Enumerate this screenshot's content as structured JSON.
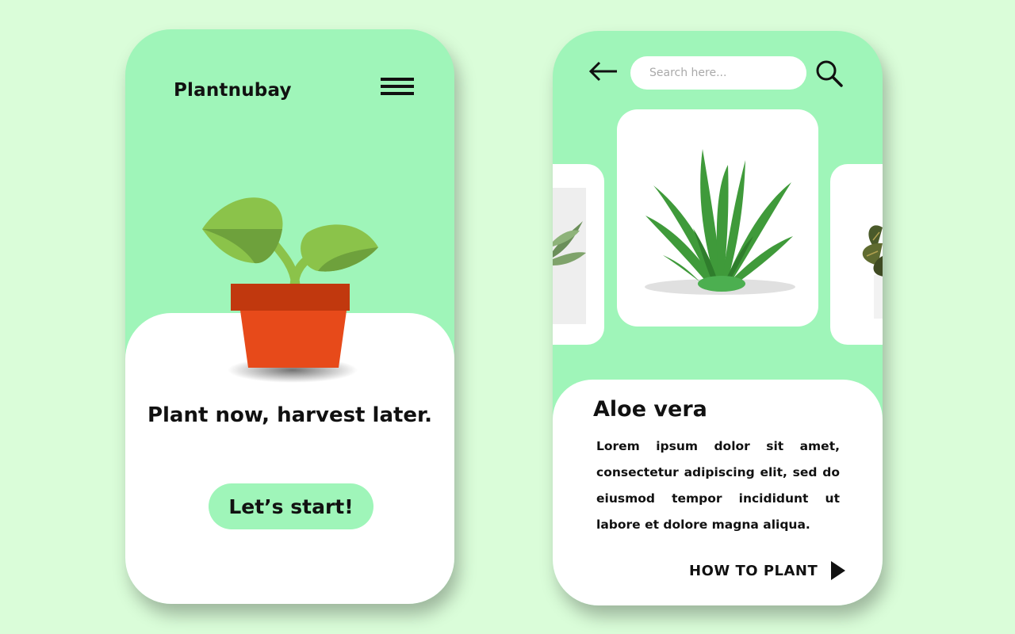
{
  "welcome": {
    "brand": "Plantnubay",
    "tagline": "Plant now, harvest later.",
    "start_label": "Let’s start!",
    "menu_icon": "hamburger-icon"
  },
  "detail": {
    "search_placeholder": "Search here...",
    "back_icon": "arrow-left-icon",
    "search_icon": "magnifier-icon",
    "plant_name": "Aloe vera",
    "description": "Lorem ipsum dolor sit amet, consectetur adipiscing elit, sed do eiusmod tempor incididunt ut labore et dolore magna aliqua.",
    "how_to_label": "HOW TO PLANT",
    "how_to_icon": "play-triangle-icon"
  },
  "colors": {
    "background": "#dafdd9",
    "phone_green": "#9ff5b9",
    "card_white": "#ffffff",
    "pot_orange": "#e74a1a",
    "pot_rim": "#c1380e",
    "leaf_light": "#8bc34a",
    "leaf_dark": "#6ea13c",
    "aloe_green": "#3f9a3a"
  }
}
